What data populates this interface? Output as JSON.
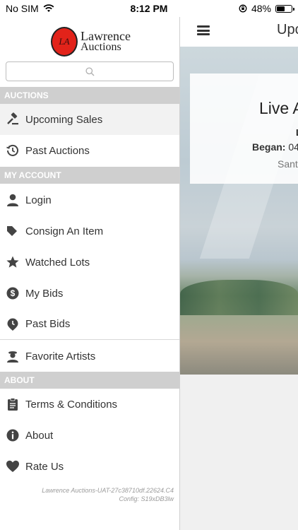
{
  "status_bar": {
    "carrier": "No SIM",
    "time": "8:12 PM",
    "battery": "48%",
    "battery_level": 0.48,
    "icons": [
      "wifi-icon",
      "orientation-lock-icon",
      "battery-icon"
    ]
  },
  "logo": {
    "initials": "LA",
    "line1": "Lawrence",
    "line2": "Auctions"
  },
  "search": {
    "placeholder": ""
  },
  "sections": {
    "auctions": "AUCTIONS",
    "account": "MY ACCOUNT",
    "about": "ABOUT"
  },
  "menu": {
    "upcoming_sales": "Upcoming Sales",
    "past_auctions": "Past Auctions",
    "login": "Login",
    "consign": "Consign An Item",
    "watched_lots": "Watched Lots",
    "my_bids": "My Bids",
    "past_bids": "Past Bids",
    "favorite_artists": "Favorite Artists",
    "terms": "Terms & Conditions",
    "about": "About",
    "rate_us": "Rate Us"
  },
  "footer": {
    "build": "Lawrence Auctions-UAT-27c38710df.22624.C4",
    "config": "Config: S19xDB3lw"
  },
  "main": {
    "nav_title": "Upco",
    "card_title": "Live A",
    "card_line2": "L",
    "card_began_label": "Began:",
    "card_began_value": "04",
    "card_location": "Sant"
  },
  "colors": {
    "section_bg": "#cfcfcf",
    "logo_red": "#e2231a",
    "active_row": "#f2f2f2"
  }
}
